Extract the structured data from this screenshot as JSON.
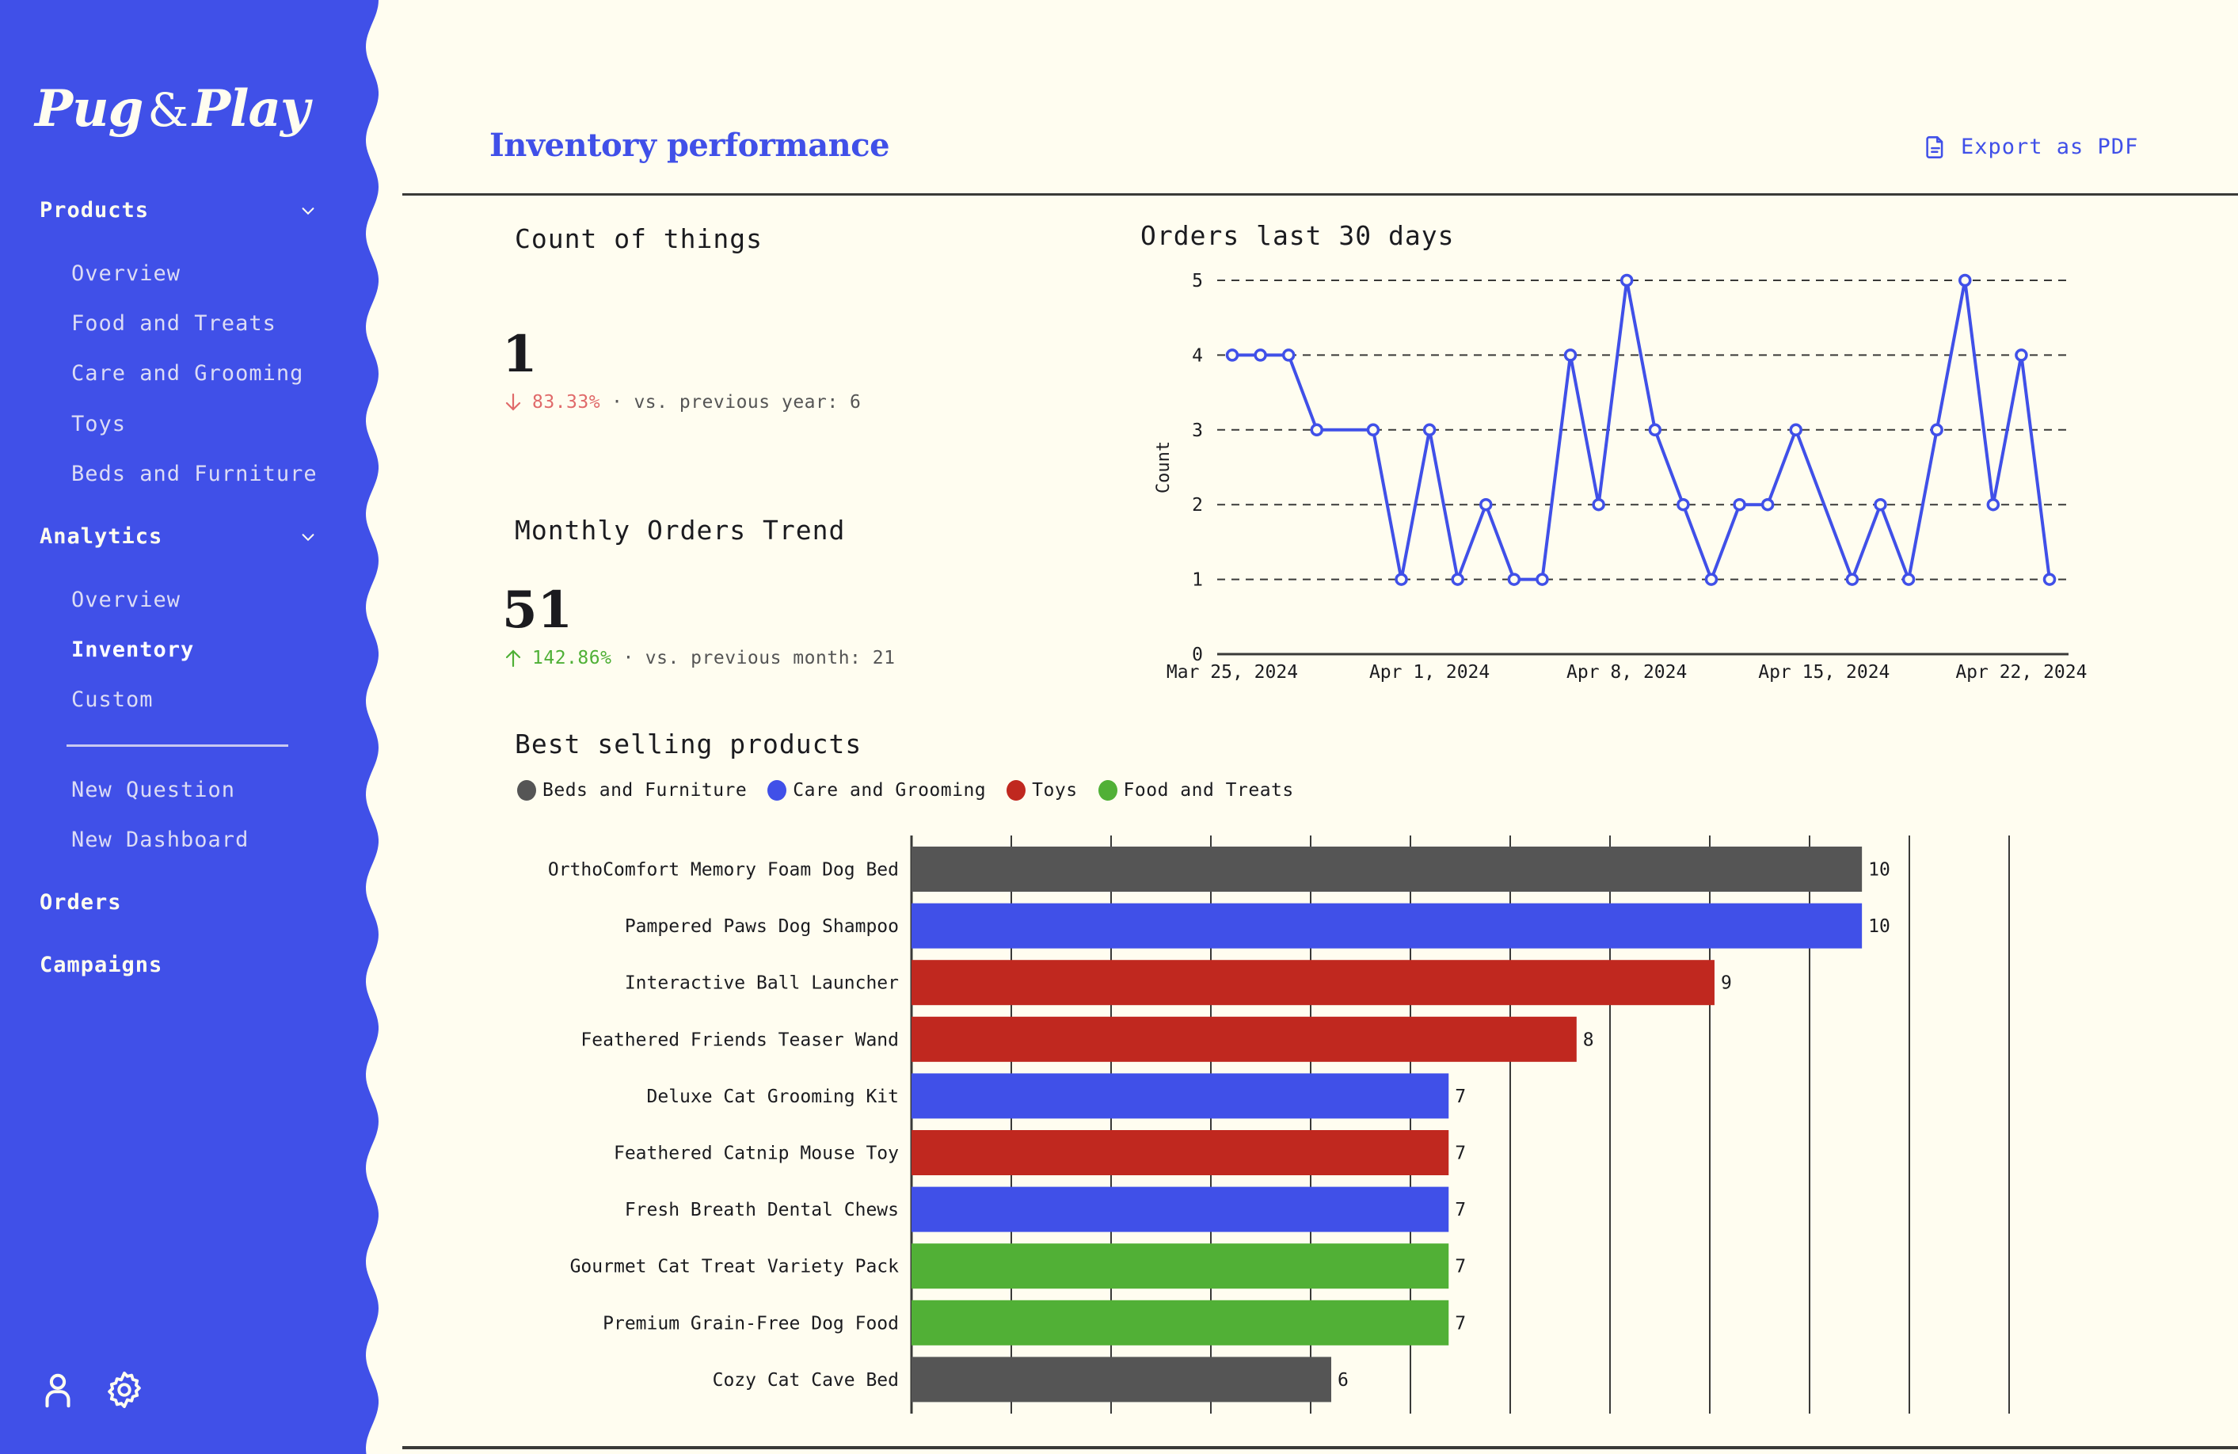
{
  "app": {
    "brand_left": "Pug",
    "brand_amp": "&",
    "brand_right": "Play",
    "accent_color": "#4050e8",
    "background_color": "#fffdf0"
  },
  "sidebar": {
    "sections": [
      {
        "label": "Products",
        "expanded": true,
        "items": [
          {
            "label": "Overview",
            "active": false
          },
          {
            "label": "Food and Treats",
            "active": false
          },
          {
            "label": "Care and Grooming",
            "active": false
          },
          {
            "label": "Toys",
            "active": false
          },
          {
            "label": "Beds and Furniture",
            "active": false
          }
        ]
      },
      {
        "label": "Analytics",
        "expanded": true,
        "items": [
          {
            "label": "Overview",
            "active": false
          },
          {
            "label": "Inventory",
            "active": true
          },
          {
            "label": "Custom",
            "active": false
          }
        ],
        "extra_items": [
          {
            "label": "New Question"
          },
          {
            "label": "New Dashboard"
          }
        ]
      },
      {
        "label": "Orders"
      },
      {
        "label": "Campaigns"
      }
    ],
    "footer_icons": [
      "user-icon",
      "settings-gear-icon"
    ]
  },
  "header": {
    "title": "Inventory performance",
    "export_label": "Export as PDF",
    "export_icon": "document-icon"
  },
  "stats": [
    {
      "title": "Count of things",
      "value": "1",
      "direction": "down",
      "change": "83.33%",
      "separator": "·",
      "comparison": "vs. previous year: 6",
      "color": "#e06a6a"
    },
    {
      "title": "Monthly Orders Trend",
      "value": "51",
      "direction": "up",
      "change": "142.86%",
      "separator": "·",
      "comparison": "vs. previous month: 21",
      "color": "#4fb036"
    }
  ],
  "chart_data": [
    {
      "type": "line",
      "title": "Orders last 30 days",
      "xlabel": "",
      "ylabel": "Count",
      "ylim": [
        0,
        5
      ],
      "yticks": [
        "0",
        "1",
        "2",
        "3",
        "4",
        "5"
      ],
      "xticks": [
        {
          "day": 0,
          "label": "Mar 25, 2024"
        },
        {
          "day": 7,
          "label": "Apr 1, 2024"
        },
        {
          "day": 14,
          "label": "Apr 8, 2024"
        },
        {
          "day": 21,
          "label": "Apr 15, 2024"
        },
        {
          "day": 28,
          "label": "Apr 22, 2024"
        }
      ],
      "grid": "horizontal-dashed",
      "color": "#4050e8",
      "points": [
        {
          "date": "2024-03-25",
          "day": 0,
          "value": 4
        },
        {
          "date": "2024-03-26",
          "day": 1,
          "value": 4
        },
        {
          "date": "2024-03-27",
          "day": 2,
          "value": 4
        },
        {
          "date": "2024-03-28",
          "day": 3,
          "value": 3
        },
        {
          "date": "2024-03-30",
          "day": 5,
          "value": 3
        },
        {
          "date": "2024-03-31",
          "day": 6,
          "value": 1
        },
        {
          "date": "2024-04-01",
          "day": 7,
          "value": 3
        },
        {
          "date": "2024-04-02",
          "day": 8,
          "value": 1
        },
        {
          "date": "2024-04-03",
          "day": 9,
          "value": 2
        },
        {
          "date": "2024-04-04",
          "day": 10,
          "value": 1
        },
        {
          "date": "2024-04-05",
          "day": 11,
          "value": 1
        },
        {
          "date": "2024-04-06",
          "day": 12,
          "value": 4
        },
        {
          "date": "2024-04-07",
          "day": 13,
          "value": 2
        },
        {
          "date": "2024-04-08",
          "day": 14,
          "value": 5
        },
        {
          "date": "2024-04-09",
          "day": 15,
          "value": 3
        },
        {
          "date": "2024-04-10",
          "day": 16,
          "value": 2
        },
        {
          "date": "2024-04-11",
          "day": 17,
          "value": 1
        },
        {
          "date": "2024-04-12",
          "day": 18,
          "value": 2
        },
        {
          "date": "2024-04-13",
          "day": 19,
          "value": 2
        },
        {
          "date": "2024-04-14",
          "day": 20,
          "value": 3
        },
        {
          "date": "2024-04-16",
          "day": 22,
          "value": 1
        },
        {
          "date": "2024-04-17",
          "day": 23,
          "value": 2
        },
        {
          "date": "2024-04-18",
          "day": 24,
          "value": 1
        },
        {
          "date": "2024-04-19",
          "day": 25,
          "value": 3
        },
        {
          "date": "2024-04-20",
          "day": 26,
          "value": 5
        },
        {
          "date": "2024-04-21",
          "day": 27,
          "value": 2
        },
        {
          "date": "2024-04-22",
          "day": 28,
          "value": 4
        },
        {
          "date": "2024-04-23",
          "day": 29,
          "value": 1
        }
      ],
      "xrange_days": [
        0,
        29
      ]
    },
    {
      "type": "bar",
      "orientation": "horizontal",
      "title": "Best selling products",
      "legend_position": "top-left",
      "legend": [
        {
          "name": "Beds and Furniture",
          "color": "#555555"
        },
        {
          "name": "Care and Grooming",
          "color": "#4050e8"
        },
        {
          "name": "Toys",
          "color": "#c0281f"
        },
        {
          "name": "Food and Treats",
          "color": "#51b036"
        }
      ],
      "grid": "vertical",
      "categories": [
        "OrthoComfort Memory Foam Dog Bed",
        "Pampered Paws Dog Shampoo",
        "Interactive Ball Launcher",
        "Feathered Friends Teaser Wand",
        "Deluxe Cat Grooming Kit",
        "Feathered Catnip Mouse Toy",
        "Fresh Breath Dental Chews",
        "Gourmet Cat Treat Variety Pack",
        "Premium Grain-Free Dog Food",
        "Cozy Cat Cave Bed"
      ],
      "groups": [
        "Beds and Furniture",
        "Care and Grooming",
        "Toys",
        "Toys",
        "Care and Grooming",
        "Toys",
        "Care and Grooming",
        "Food and Treats",
        "Food and Treats",
        "Beds and Furniture"
      ],
      "values": [
        10,
        10,
        9,
        8,
        7,
        7,
        7,
        7,
        7,
        6
      ],
      "data_labels": [
        "10",
        "10",
        "9",
        "8",
        "7",
        "7",
        "7",
        "7",
        "7",
        "6"
      ],
      "xlabel": "",
      "ylabel": ""
    }
  ]
}
